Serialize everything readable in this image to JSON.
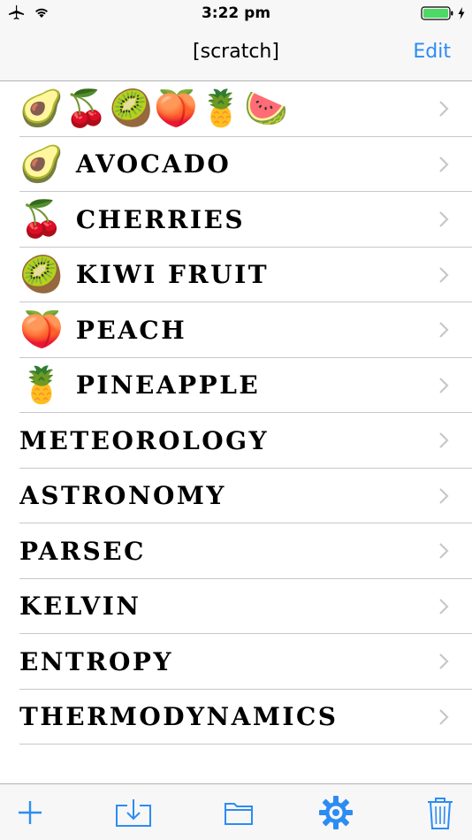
{
  "status_bar": {
    "time": "3:22 pm",
    "airplane_icon": "airplane-icon",
    "wifi_icon": "wifi-icon",
    "battery_icon": "battery-icon",
    "charging_icon": "charging-bolt-icon"
  },
  "nav": {
    "title": "[scratch]",
    "edit_label": "Edit"
  },
  "list": {
    "items": [
      {
        "emoji": "🥑🍒🥝🍑🍍🍉",
        "label": ""
      },
      {
        "emoji": "🥑",
        "label": "AVOCADO"
      },
      {
        "emoji": "🍒",
        "label": "CHERRIES"
      },
      {
        "emoji": "🥝",
        "label": "KIWI FRUIT"
      },
      {
        "emoji": "🍑",
        "label": "PEACH"
      },
      {
        "emoji": "🍍",
        "label": "PINEAPPLE"
      },
      {
        "emoji": "",
        "label": "METEOROLOGY"
      },
      {
        "emoji": "",
        "label": "ASTRONOMY"
      },
      {
        "emoji": "",
        "label": "PARSEC"
      },
      {
        "emoji": "",
        "label": "KELVIN"
      },
      {
        "emoji": "",
        "label": "ENTROPY"
      },
      {
        "emoji": "",
        "label": "THERMODYNAMICS"
      }
    ]
  },
  "toolbar": {
    "icons": [
      "plus-icon",
      "import-icon",
      "folder-icon",
      "gear-icon",
      "trash-icon"
    ]
  },
  "colors": {
    "accent": "#2c8cf4",
    "battery": "#4cd964",
    "separator": "#c8c7cc"
  }
}
